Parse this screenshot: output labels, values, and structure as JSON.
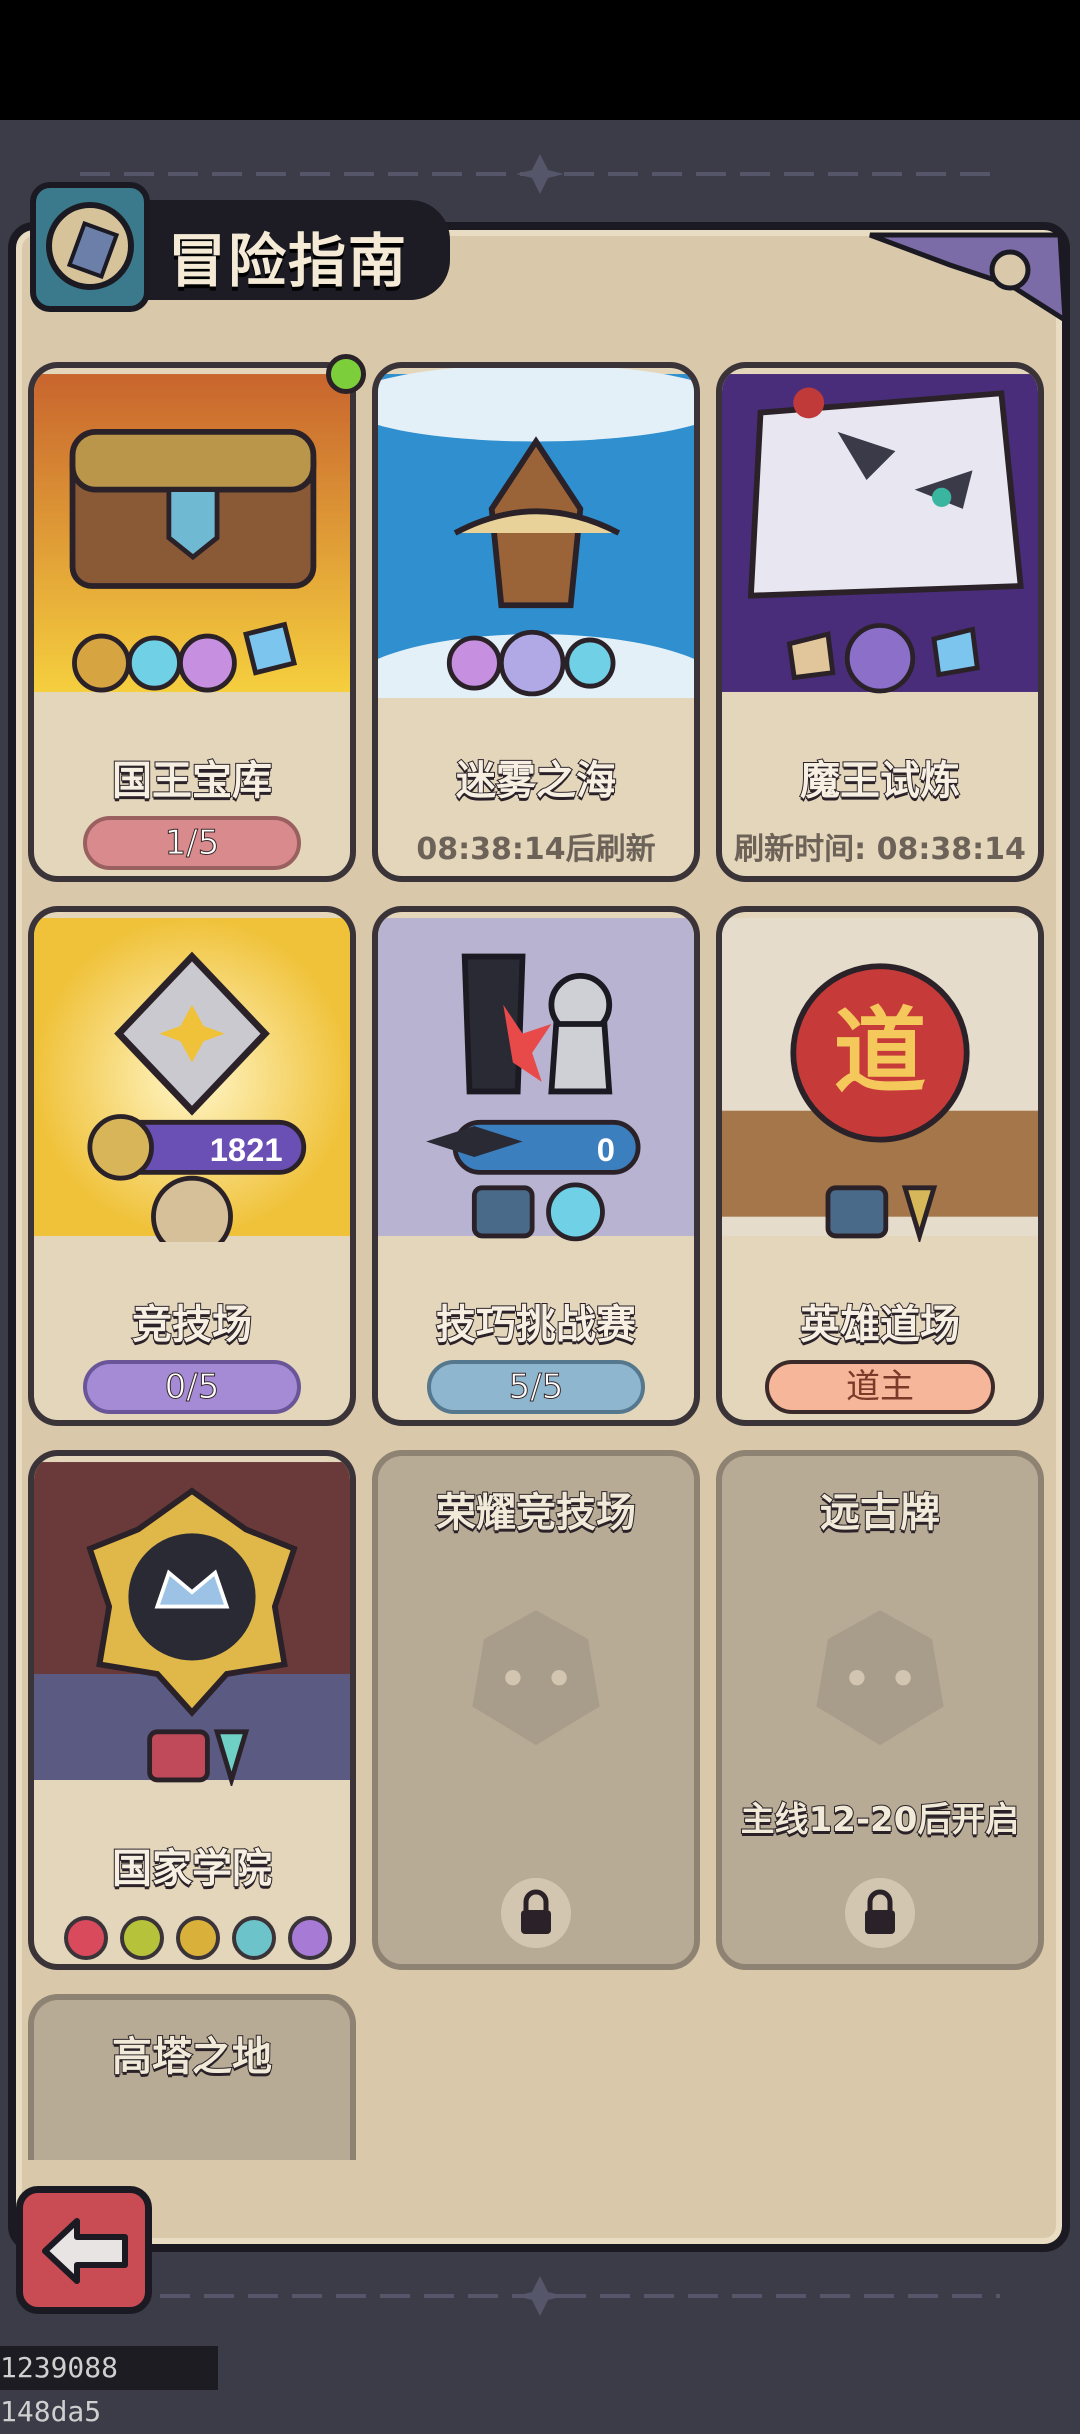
{
  "header": {
    "title": "冒险指南"
  },
  "cards": [
    {
      "name": "国王宝库",
      "progress": "1/5",
      "has_badge": true
    },
    {
      "name": "迷雾之海",
      "status": "08:38:14后刷新"
    },
    {
      "name": "魔王试炼",
      "status": "刷新时间: 08:38:14"
    },
    {
      "name": "竞技场",
      "score": "1821",
      "progress": "0/5"
    },
    {
      "name": "技巧挑战赛",
      "score": "0",
      "progress": "5/5"
    },
    {
      "name": "英雄道场",
      "emblem": "道",
      "rank": "道主"
    },
    {
      "name": "国家学院"
    },
    {
      "name": "荣耀竞技场",
      "locked": true
    },
    {
      "name": "远古牌",
      "locked": true,
      "unlock_condition": "主线12-20后开启"
    },
    {
      "name": "高塔之地",
      "locked": true
    }
  ],
  "academy_dots": [
    "#d84a5c",
    "#b6c23a",
    "#d9b13a",
    "#6cc3c9",
    "#a77ad6"
  ],
  "debug_text": "1239088 148da5",
  "colors": {
    "panel": "#d9c9aa",
    "frame": "#1b1a22",
    "back_button": "#c94c55"
  }
}
